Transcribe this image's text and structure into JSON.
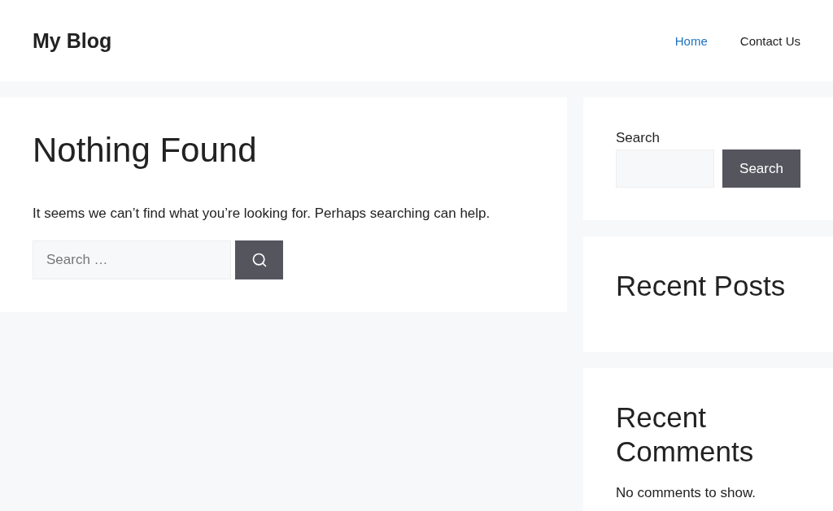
{
  "site_title": "My Blog",
  "nav": [
    {
      "label": "Home",
      "selected": true
    },
    {
      "label": "Contact Us",
      "selected": false
    }
  ],
  "main": {
    "title": "Nothing Found",
    "message": "It seems we can’t find what you’re looking for. Perhaps searching can help.",
    "search": {
      "placeholder": "Search …"
    }
  },
  "sidebar": [
    {
      "kind": "search",
      "label": "Search",
      "button": "Search"
    },
    {
      "kind": "heading",
      "title": "Recent Posts"
    },
    {
      "kind": "heading",
      "title": "Recent Comments",
      "text": "No comments to show."
    }
  ]
}
